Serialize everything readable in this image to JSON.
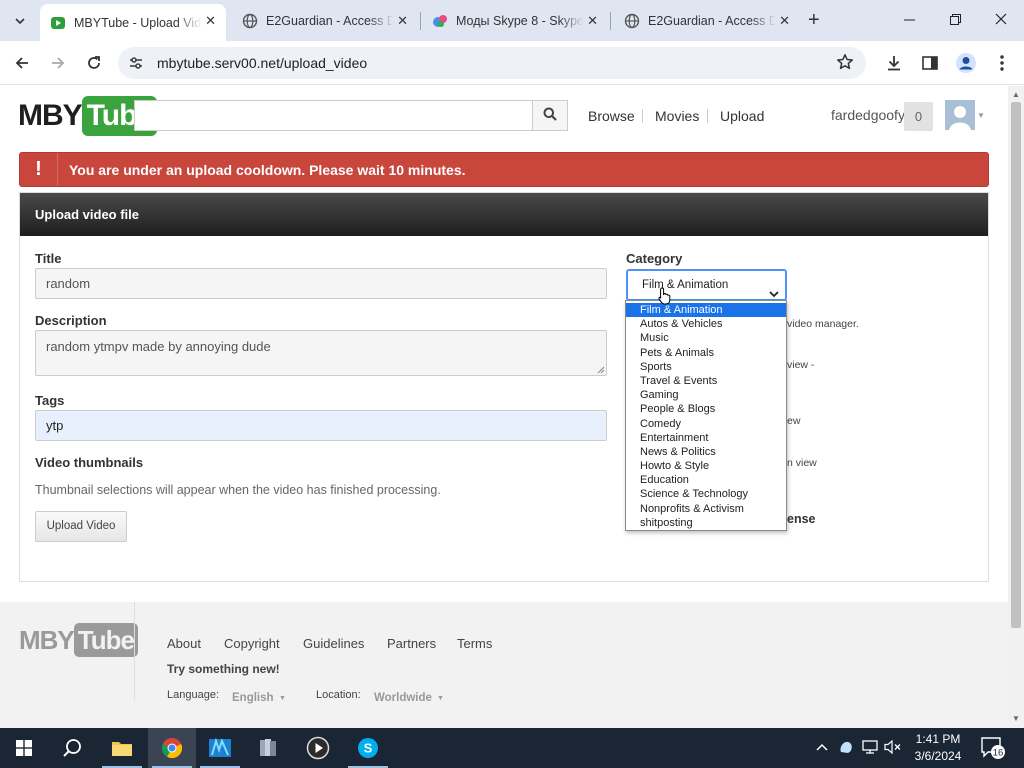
{
  "browser": {
    "tabs": [
      {
        "title": "MBYTube - Upload Video",
        "active": true,
        "favicon": "youtube-play-icon"
      },
      {
        "title": "E2Guardian - Access Denied",
        "active": false,
        "favicon": "globe-icon"
      },
      {
        "title": "Моды Skype 8 - Skype",
        "active": false,
        "favicon": "skype-mod-icon"
      },
      {
        "title": "E2Guardian - Access Denied",
        "active": false,
        "favicon": "globe-icon"
      }
    ],
    "url": "mbytube.serv00.net/upload_video"
  },
  "site": {
    "logo": {
      "part1": "MBY",
      "part2": "Tube"
    },
    "nav": [
      "Browse",
      "Movies",
      "Upload"
    ],
    "username": "fardedgoofy",
    "notifications": "0"
  },
  "alert": {
    "icon": "!",
    "message": "You are under an upload cooldown. Please wait 10 minutes."
  },
  "form": {
    "header": "Upload video file",
    "title_label": "Title",
    "title_value": "random",
    "description_label": "Description",
    "description_value": "random ytmpv made by annoying dude",
    "tags_label": "Tags",
    "tags_value": "ytp",
    "thumbnails_label": "Video thumbnails",
    "thumbnails_hint": "Thumbnail selections will appear when the video has finished processing.",
    "upload_button": "Upload Video",
    "category_label": "Category",
    "category_selected": "Film & Animation",
    "category_options": [
      "Film & Animation",
      "Autos & Vehicles",
      "Music",
      "Pets & Animals",
      "Sports",
      "Travel & Events",
      "Gaming",
      "People & Blogs",
      "Comedy",
      "Entertainment",
      "News & Politics",
      "Howto & Style",
      "Education",
      "Science & Technology",
      "Nonprofits & Activism",
      "shitposting"
    ],
    "side_fragments": [
      "video manager.",
      "view -",
      "ew",
      "n view"
    ],
    "side_bold_fragment": "ense"
  },
  "footer": {
    "links": [
      "About",
      "Copyright",
      "Guidelines",
      "Partners",
      "Terms"
    ],
    "try": "Try something new!",
    "language_label": "Language:",
    "language_value": "English",
    "location_label": "Location:",
    "location_value": "Worldwide"
  },
  "taskbar": {
    "time": "1:41 PM",
    "date": "3/6/2024",
    "notification_count": "16"
  },
  "colors": {
    "brand_green": "#3aa33e",
    "alert_red": "#c9463d",
    "selection_blue": "#1a73e8"
  }
}
